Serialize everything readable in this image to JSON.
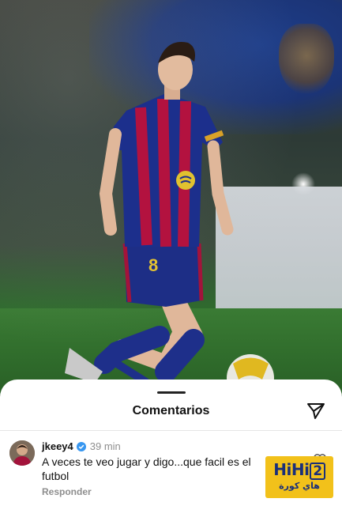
{
  "sheet": {
    "title": "Comentarios"
  },
  "comment": {
    "username": "jkeey4",
    "time": "39 min",
    "text": "A veces te veo jugar y digo...que facil es el futbol",
    "reply_label": "Responder"
  },
  "watermark": {
    "latin_prefix": "HiHi",
    "latin_number": "2",
    "arabic": "هاي كورة"
  },
  "jersey": {
    "number": "8"
  },
  "colors": {
    "sheet_bg": "#ffffff",
    "verified": "#3897f0",
    "muted_text": "#8e8e8e",
    "watermark_bg": "#f2c11a",
    "watermark_text": "#1a2f7a"
  }
}
